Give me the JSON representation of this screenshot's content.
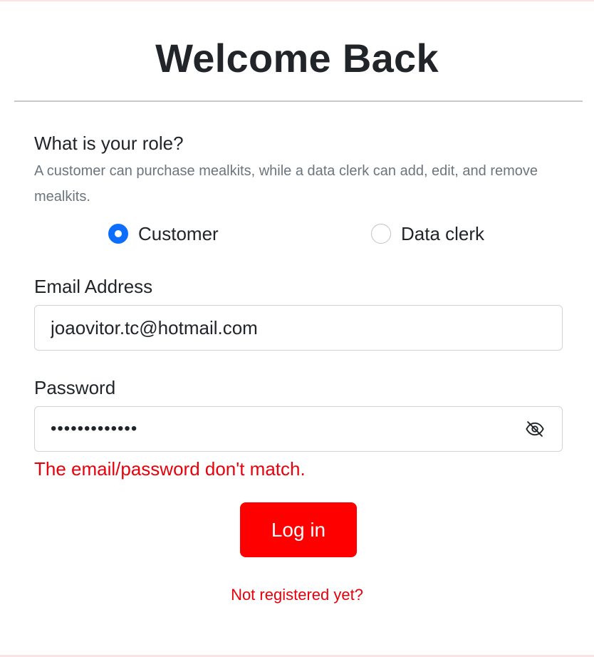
{
  "header": {
    "title": "Welcome Back"
  },
  "role": {
    "question": "What is your role?",
    "help": "A customer can purchase mealkits, while a data clerk can add, edit, and remove mealkits.",
    "options": [
      {
        "label": "Customer",
        "checked": true
      },
      {
        "label": "Data clerk",
        "checked": false
      }
    ],
    "accent_color": "#0d6efd"
  },
  "email": {
    "label": "Email Address",
    "value": "joaovitor.tc@hotmail.com"
  },
  "password": {
    "label": "Password",
    "value": "•••••••••••••",
    "toggle_icon": "eye-slash-icon"
  },
  "error": {
    "message": "The email/password don't match.",
    "color": "#e8000b"
  },
  "actions": {
    "login_label": "Log in",
    "login_color": "#ff0000",
    "register_link": "Not registered yet?"
  }
}
